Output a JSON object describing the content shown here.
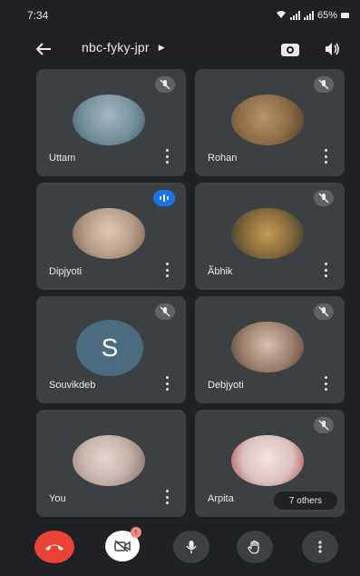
{
  "status_bar": {
    "time": "7:34",
    "battery": "65%"
  },
  "meeting": {
    "code": "nbc-fyky-jpr"
  },
  "participants": [
    {
      "name": "Uttam",
      "muted": true,
      "speaking": false,
      "avatar_color": "#6f8c96"
    },
    {
      "name": "Rohan",
      "muted": true,
      "speaking": false,
      "avatar_color": "#8a6a45"
    },
    {
      "name": "Dipjyoti",
      "muted": false,
      "speaking": true,
      "avatar_color": "#b59b85"
    },
    {
      "name": "Ãbhik",
      "muted": true,
      "speaking": false,
      "avatar_color": "#8a6c3a"
    },
    {
      "name": "Souvikdeb",
      "muted": true,
      "speaking": false,
      "avatar_letter": "S",
      "avatar_color": "#4a6b80"
    },
    {
      "name": "Debjyoti",
      "muted": true,
      "speaking": false,
      "avatar_color": "#9c7f6c"
    },
    {
      "name": "You",
      "muted": false,
      "speaking": false,
      "avatar_color": "#c4b2a6"
    },
    {
      "name": "Arpita",
      "muted": true,
      "speaking": false,
      "avatar_color": "#d9c1bd"
    }
  ],
  "others_label": "7 others",
  "controls": {
    "camera_badge": "!"
  },
  "colors": {
    "background": "#202124",
    "tile": "#3c4043",
    "end_call": "#ea4335",
    "speaking": "#1a73e8"
  }
}
